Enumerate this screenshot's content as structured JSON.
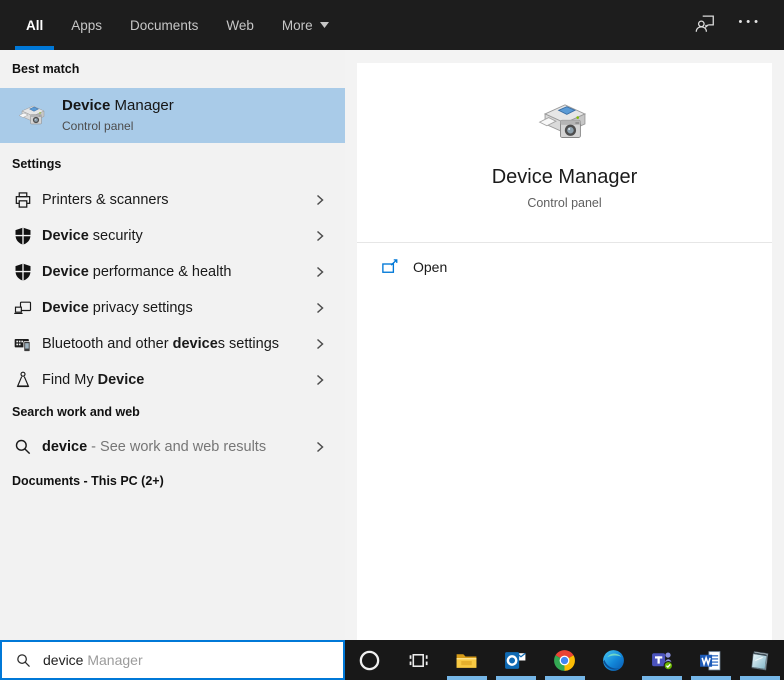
{
  "topbar": {
    "tabs": [
      {
        "label": "All",
        "active": true
      },
      {
        "label": "Apps",
        "active": false
      },
      {
        "label": "Documents",
        "active": false
      },
      {
        "label": "Web",
        "active": false
      },
      {
        "label": "More",
        "active": false
      }
    ],
    "ellipsis": "•••"
  },
  "left_panel": {
    "best_match": {
      "header": "Best match",
      "title_bold": "Device",
      "title_rest": " Manager",
      "subtitle": "Control panel"
    },
    "settings": {
      "header": "Settings",
      "items": [
        {
          "pre": "Printers & scanners",
          "bold": "",
          "post": "",
          "icon": "printer-icon"
        },
        {
          "pre": "",
          "bold": "Device",
          "post": " security",
          "icon": "shield-icon"
        },
        {
          "pre": "",
          "bold": "Device",
          "post": " performance & health",
          "icon": "shield-icon"
        },
        {
          "pre": "",
          "bold": "Device",
          "post": " privacy settings",
          "icon": "devices-icon"
        },
        {
          "pre": "Bluetooth and other ",
          "bold": "device",
          "post": "s settings",
          "icon": "keyboard-phone-icon"
        },
        {
          "pre": "Find My ",
          "bold": "Device",
          "post": "",
          "icon": "person-pin-icon"
        }
      ]
    },
    "search_web": {
      "header": "Search work and web",
      "query": "device",
      "suffix": " - See work and web results"
    },
    "documents_header": "Documents - This PC (2+)"
  },
  "search_box": {
    "typed": "device",
    "suggestion": " Manager"
  },
  "preview_panel": {
    "title": "Device Manager",
    "subtitle": "Control panel",
    "open_label": "Open"
  },
  "taskbar": {
    "items": [
      {
        "icon": "cortana-icon",
        "running": false
      },
      {
        "icon": "task-view-icon",
        "running": false
      },
      {
        "icon": "file-explorer-icon",
        "running": true
      },
      {
        "icon": "outlook-icon",
        "running": true
      },
      {
        "icon": "chrome-icon",
        "running": true
      },
      {
        "icon": "edge-icon",
        "running": false
      },
      {
        "icon": "teams-icon",
        "running": true
      },
      {
        "icon": "word-icon",
        "running": true
      },
      {
        "icon": "notepad-icon",
        "running": true
      }
    ]
  },
  "colors": {
    "accent": "#0078d7",
    "best_match_highlight": "#a9cbe8",
    "taskbar_indicator": "#75b6e7",
    "topbar_bg": "#1d1d1d",
    "panel_bg": "#f2f2f2"
  }
}
